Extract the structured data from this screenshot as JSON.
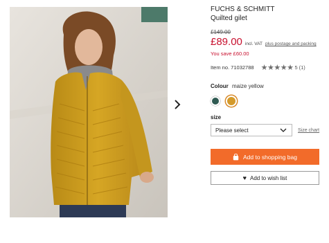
{
  "product": {
    "brand": "FUCHS & SCHMITT",
    "name": "Quilted gilet",
    "image_alt": "Woman wearing a maize yellow quilted gilet"
  },
  "pricing": {
    "old_price": "£149.00",
    "price": "£89.00",
    "vat_note": "incl. VAT",
    "shipping_link": "plus postage and packing",
    "saving": "You save £60.00",
    "price_color": "#c8102e"
  },
  "details": {
    "item_number": "Item no. 71032788",
    "rating_stars": 5,
    "rating_text": "5",
    "review_count": "(1)"
  },
  "colour": {
    "label": "Colour",
    "selected": "maize yellow",
    "options": [
      {
        "name": "dark green",
        "hex": "#2f5a52"
      },
      {
        "name": "maize yellow",
        "hex": "#d49a2a"
      }
    ]
  },
  "size": {
    "label": "size",
    "select_value": "Please select",
    "size_chart_link": "Size chart"
  },
  "actions": {
    "add_to_bag": "Add to shopping bag",
    "add_to_wishlist": "Add to wish list",
    "accent_color": "#f26b2a"
  },
  "gallery": {
    "next_icon": "chevron-right-icon"
  }
}
